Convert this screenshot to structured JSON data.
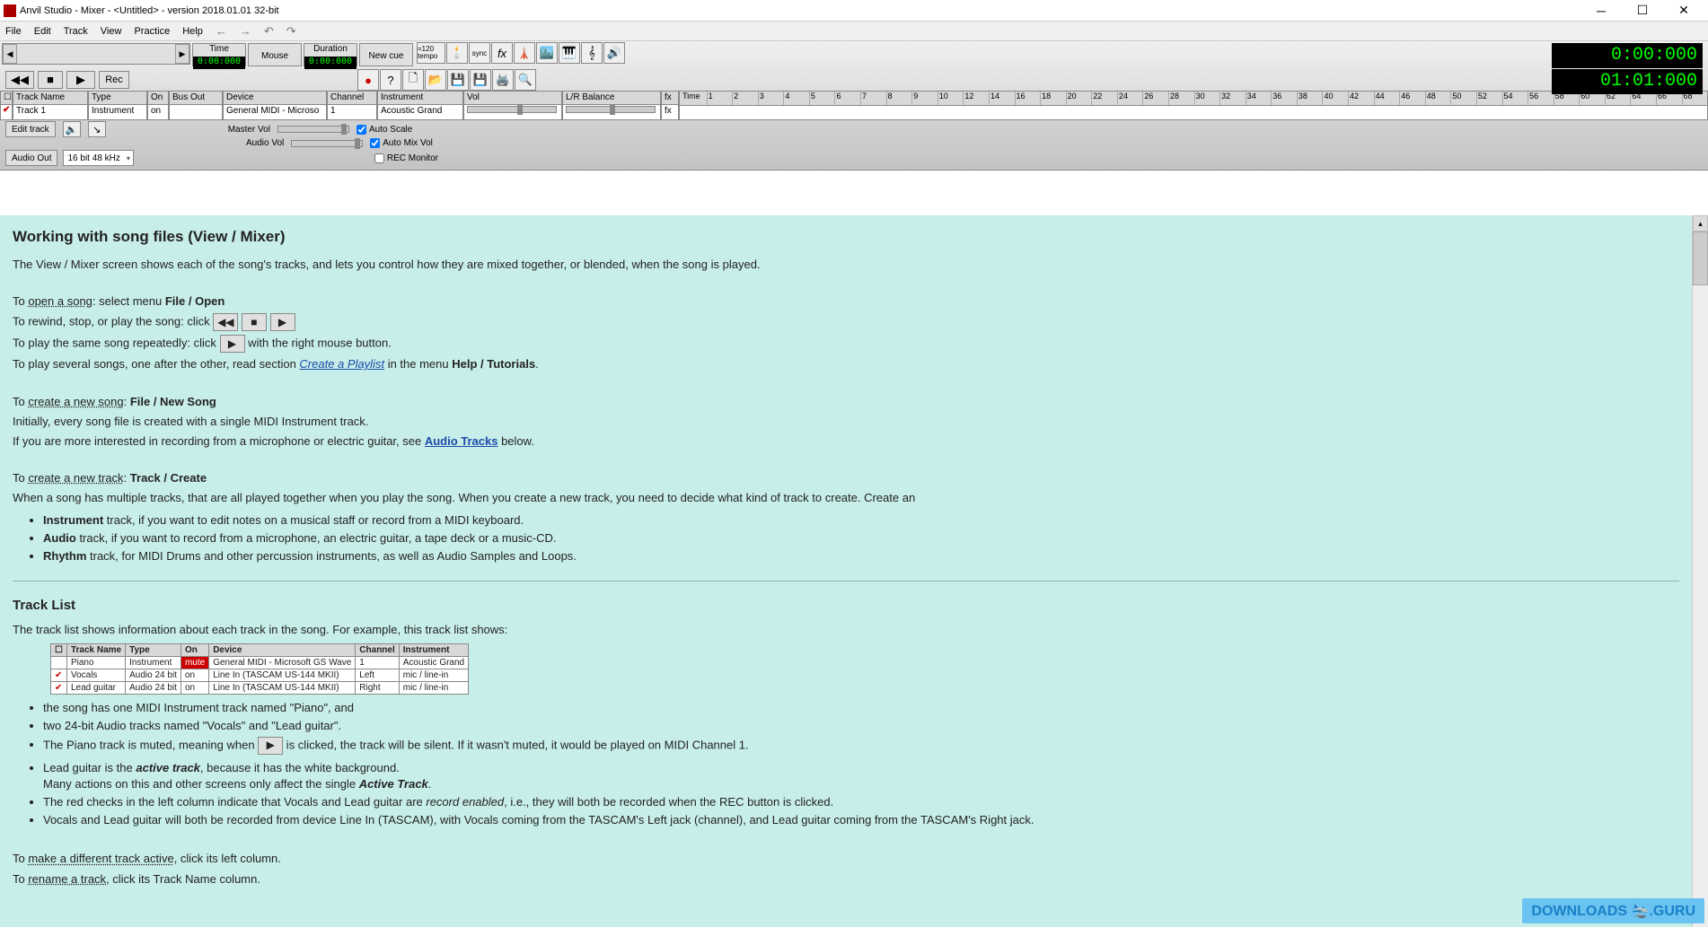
{
  "title": "Anvil Studio - Mixer - <Untitled> - version 2018.01.01 32-bit",
  "menu": {
    "items": [
      "File",
      "Edit",
      "Track",
      "View",
      "Practice",
      "Help"
    ]
  },
  "info": {
    "time_label": "Time",
    "time_val": "0:00:000",
    "mouse_label": "Mouse",
    "duration_label": "Duration",
    "duration_val": "0:00:000",
    "newcue_label": "New cue"
  },
  "tempo_label": "=120\ntempo",
  "transport": {
    "rec": "Rec"
  },
  "big_display": {
    "top": "0:00:000",
    "bottom": "01:01:000"
  },
  "trackgrid": {
    "headers": {
      "trackname": "Track Name",
      "type": "Type",
      "on": "On",
      "busout": "Bus Out",
      "device": "Device",
      "channel": "Channel",
      "instrument": "Instrument",
      "vol": "Vol",
      "lr": "L/R Balance",
      "fx": "fx",
      "time": "Time"
    },
    "row": {
      "trackname": "Track 1",
      "type": "Instrument",
      "on": "on",
      "busout": "",
      "device": "General MIDI - Microso",
      "channel": "1",
      "instrument": "Acoustic Grand",
      "fx": "fx"
    }
  },
  "ruler": [
    "1",
    "2",
    "3",
    "4",
    "5",
    "6",
    "7",
    "8",
    "9",
    "10",
    "12",
    "14",
    "16",
    "18",
    "20",
    "22",
    "24",
    "26",
    "28",
    "30",
    "32",
    "34",
    "36",
    "38",
    "40",
    "42",
    "44",
    "46",
    "48",
    "50",
    "52",
    "54",
    "56",
    "58",
    "60",
    "62",
    "64",
    "66",
    "68"
  ],
  "controls": {
    "edit_track": "Edit track",
    "master_vol": "Master Vol",
    "audio_vol": "Audio Vol",
    "auto_scale": "Auto Scale",
    "auto_mix": "Auto Mix Vol",
    "rec_mon": "REC Monitor",
    "audio_out": "Audio Out",
    "audio_out_val": "16 bit 48 kHz"
  },
  "help": {
    "h1": "Working with song files (View / Mixer)",
    "p1": "The View / Mixer screen shows each of the song's tracks, and lets you control how they are mixed together, or blended, when the song is played.",
    "p2a": "To ",
    "p2b": "open a song",
    "p2c": ": select menu ",
    "p2d": "File / Open",
    "p3": "To rewind, stop, or play the song: click",
    "p4a": "To play the same song repeatedly: click ",
    "p4b": " with the right mouse button.",
    "p5a": "To play several songs, one after the other, read section ",
    "p5b": "Create a Playlist",
    "p5c": " in the menu ",
    "p5d": "Help / Tutorials",
    "p5e": ".",
    "p6a": "To ",
    "p6b": "create a new song",
    "p6c": ": ",
    "p6d": "File / New Song",
    "p7": "Initially, every song file is created with a single MIDI Instrument track.",
    "p8a": "If you are more interested in recording from a microphone or electric guitar, see ",
    "p8b": "Audio Tracks",
    "p8c": " below.",
    "p9a": "To ",
    "p9b": "create a new track",
    "p9c": ": ",
    "p9d": "Track / Create",
    "p10": "When a song has multiple tracks, that are all played together when you play the song. When you create a new track, you need to decide what kind of track to create. Create an",
    "li1a": "Instrument",
    "li1b": " track, if you want to edit notes on a musical staff or record from a MIDI keyboard.",
    "li2a": "Audio",
    "li2b": " track, if you want to record from a microphone, an electric guitar, a tape deck or a music-CD.",
    "li3a": "Rhythm",
    "li3b": " track, for MIDI Drums and other percussion instruments, as well as Audio Samples and Loops.",
    "h2": "Track List",
    "p11": "The track list shows information about each track in the song. For example, this track list shows:",
    "ex_headers": [
      "",
      "Track Name",
      "Type",
      "On",
      "Device",
      "Channel",
      "Instrument"
    ],
    "ex_rows": [
      [
        "",
        "Piano",
        "Instrument",
        "mute",
        "General MIDI - Microsoft GS Wave",
        "1",
        "Acoustic Grand"
      ],
      [
        "✔",
        "Vocals",
        "Audio 24 bit",
        "on",
        "Line In (TASCAM US-144 MKII)",
        "Left",
        "mic / line-in"
      ],
      [
        "✔",
        "Lead guitar",
        "Audio 24 bit",
        "on",
        "Line In (TASCAM US-144 MKII)",
        "Right",
        "mic / line-in"
      ]
    ],
    "li4": "the song has one MIDI Instrument track named \"Piano\", and",
    "li5": "two 24-bit Audio tracks named \"Vocals\" and \"Lead guitar\".",
    "li6a": "The Piano track is muted, meaning when ",
    "li6b": " is clicked, the track will be silent. If it wasn't muted, it would be played on MIDI Channel 1.",
    "li7a": "Lead guitar is the ",
    "li7b": "active track",
    "li7c": ", because it has the white background.",
    "li7d": "Many actions on this and other screens only affect the single ",
    "li7e": "Active Track",
    "li7f": ".",
    "li8a": "The red checks in the left column indicate that Vocals and Lead guitar are ",
    "li8b": "record enabled",
    "li8c": ", i.e., they will both be recorded when the REC button is clicked.",
    "li9": "Vocals and Lead guitar will both be recorded from device Line In (TASCAM), with Vocals coming from the TASCAM's Left jack (channel), and Lead guitar coming from the TASCAM's Right jack.",
    "p12a": "To ",
    "p12b": "make a different track active",
    "p12c": ", click its left column.",
    "p13a": "To ",
    "p13b": "rename a track",
    "p13c": ", click its Track Name column."
  },
  "watermark": "DOWNLOADS 🛬.GURU"
}
